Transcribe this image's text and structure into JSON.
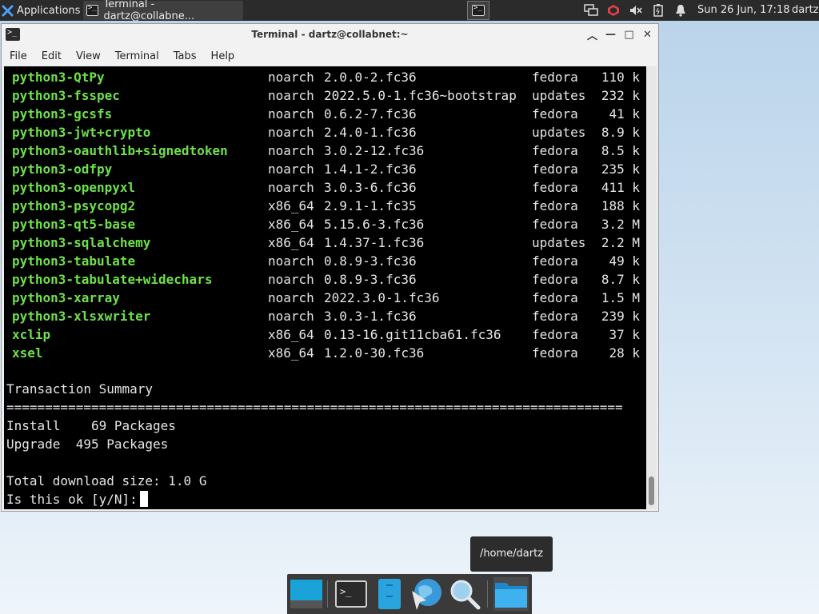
{
  "top_panel": {
    "applications_label": "Applications",
    "task_label": "Terminal - dartz@collabne...",
    "clock": "Sun 26 Jun, 17:18",
    "user": "dartz"
  },
  "window": {
    "title": "Terminal - dartz@collabnet:~",
    "menu": [
      "File",
      "Edit",
      "View",
      "Terminal",
      "Tabs",
      "Help"
    ]
  },
  "terminal": {
    "packages": [
      {
        "name": "python3-QtPy",
        "arch": "noarch",
        "version": "2.0.0-2.fc36",
        "repo": "fedora",
        "size": "110 k"
      },
      {
        "name": "python3-fsspec",
        "arch": "noarch",
        "version": "2022.5.0-1.fc36~bootstrap",
        "repo": "updates",
        "size": "232 k"
      },
      {
        "name": "python3-gcsfs",
        "arch": "noarch",
        "version": "0.6.2-7.fc36",
        "repo": "fedora",
        "size": "41 k"
      },
      {
        "name": "python3-jwt+crypto",
        "arch": "noarch",
        "version": "2.4.0-1.fc36",
        "repo": "updates",
        "size": "8.9 k"
      },
      {
        "name": "python3-oauthlib+signedtoken",
        "arch": "noarch",
        "version": "3.0.2-12.fc36",
        "repo": "fedora",
        "size": "8.5 k"
      },
      {
        "name": "python3-odfpy",
        "arch": "noarch",
        "version": "1.4.1-2.fc36",
        "repo": "fedora",
        "size": "235 k"
      },
      {
        "name": "python3-openpyxl",
        "arch": "noarch",
        "version": "3.0.3-6.fc36",
        "repo": "fedora",
        "size": "411 k"
      },
      {
        "name": "python3-psycopg2",
        "arch": "x86_64",
        "version": "2.9.1-1.fc35",
        "repo": "fedora",
        "size": "188 k"
      },
      {
        "name": "python3-qt5-base",
        "arch": "x86_64",
        "version": "5.15.6-3.fc36",
        "repo": "fedora",
        "size": "3.2 M"
      },
      {
        "name": "python3-sqlalchemy",
        "arch": "x86_64",
        "version": "1.4.37-1.fc36",
        "repo": "updates",
        "size": "2.2 M"
      },
      {
        "name": "python3-tabulate",
        "arch": "noarch",
        "version": "0.8.9-3.fc36",
        "repo": "fedora",
        "size": "49 k"
      },
      {
        "name": "python3-tabulate+widechars",
        "arch": "noarch",
        "version": "0.8.9-3.fc36",
        "repo": "fedora",
        "size": "8.7 k"
      },
      {
        "name": "python3-xarray",
        "arch": "noarch",
        "version": "2022.3.0-1.fc36",
        "repo": "fedora",
        "size": "1.5 M"
      },
      {
        "name": "python3-xlsxwriter",
        "arch": "noarch",
        "version": "3.0.3-1.fc36",
        "repo": "fedora",
        "size": "239 k"
      },
      {
        "name": "xclip",
        "arch": "x86_64",
        "version": "0.13-16.git11cba61.fc36",
        "repo": "fedora",
        "size": "37 k"
      },
      {
        "name": "xsel",
        "arch": "x86_64",
        "version": "1.2.0-30.fc36",
        "repo": "fedora",
        "size": "28 k"
      }
    ],
    "summary_title": "Transaction Summary",
    "separator": "================================================================================",
    "install_line": "Install    69 Packages",
    "upgrade_line": "Upgrade  495 Packages",
    "download_line": "Total download size: 1.0 G",
    "prompt": "Is this ok [y/N]:"
  },
  "tooltip": "/home/dartz",
  "dock": {
    "items": [
      "show-desktop",
      "terminal",
      "file-manager-alt",
      "web-browser",
      "app-finder",
      "home-folder"
    ]
  }
}
